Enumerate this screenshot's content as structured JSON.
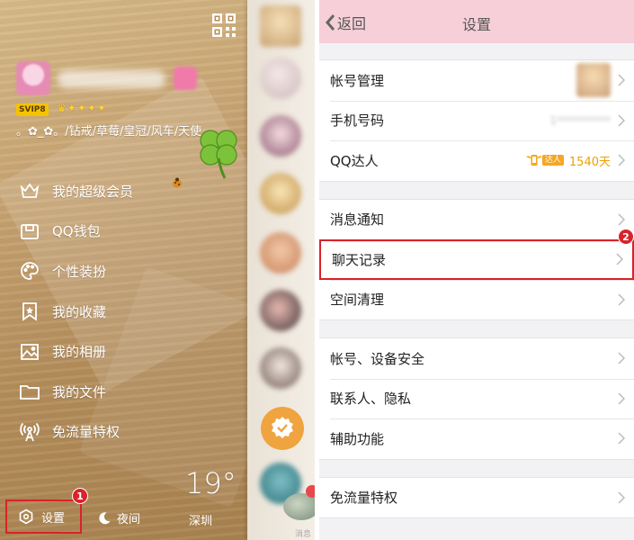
{
  "left_panel": {
    "svip_label": "SVIP8",
    "signature": "。✿_✿。/钻戒/草莓/皇冠/风车/天使...",
    "menu": [
      {
        "label": "我的超级会员",
        "icon": "crown-icon"
      },
      {
        "label": "QQ钱包",
        "icon": "wallet-icon"
      },
      {
        "label": "个性装扮",
        "icon": "palette-icon"
      },
      {
        "label": "我的收藏",
        "icon": "bookmark-star-icon"
      },
      {
        "label": "我的相册",
        "icon": "photo-icon"
      },
      {
        "label": "我的文件",
        "icon": "folder-icon"
      },
      {
        "label": "免流量特权",
        "icon": "signal-tower-icon"
      }
    ],
    "weather": {
      "temp": "19°",
      "city": "深圳"
    },
    "settings_label": "设置",
    "night_label": "夜间",
    "step_marker": "1",
    "msg_label": "消息"
  },
  "settings_page": {
    "back_label": "返回",
    "title": "设置",
    "groups": [
      [
        {
          "label": "帐号管理",
          "extra": "avatar"
        },
        {
          "label": "手机号码",
          "extra": "phone",
          "value": "1**********"
        },
        {
          "label": "QQ达人",
          "extra": "days",
          "badge": "达人",
          "value": "1540天"
        }
      ],
      [
        {
          "label": "消息通知"
        },
        {
          "label": "聊天记录",
          "highlighted": true
        },
        {
          "label": "空间清理"
        }
      ],
      [
        {
          "label": "帐号、设备安全"
        },
        {
          "label": "联系人、隐私"
        },
        {
          "label": "辅助功能"
        }
      ],
      [
        {
          "label": "免流量特权"
        }
      ]
    ],
    "step_marker": "2"
  },
  "colors": {
    "highlight": "#d9222a",
    "titlebar": "#f6cfd9",
    "accent_orange": "#f0a000"
  }
}
